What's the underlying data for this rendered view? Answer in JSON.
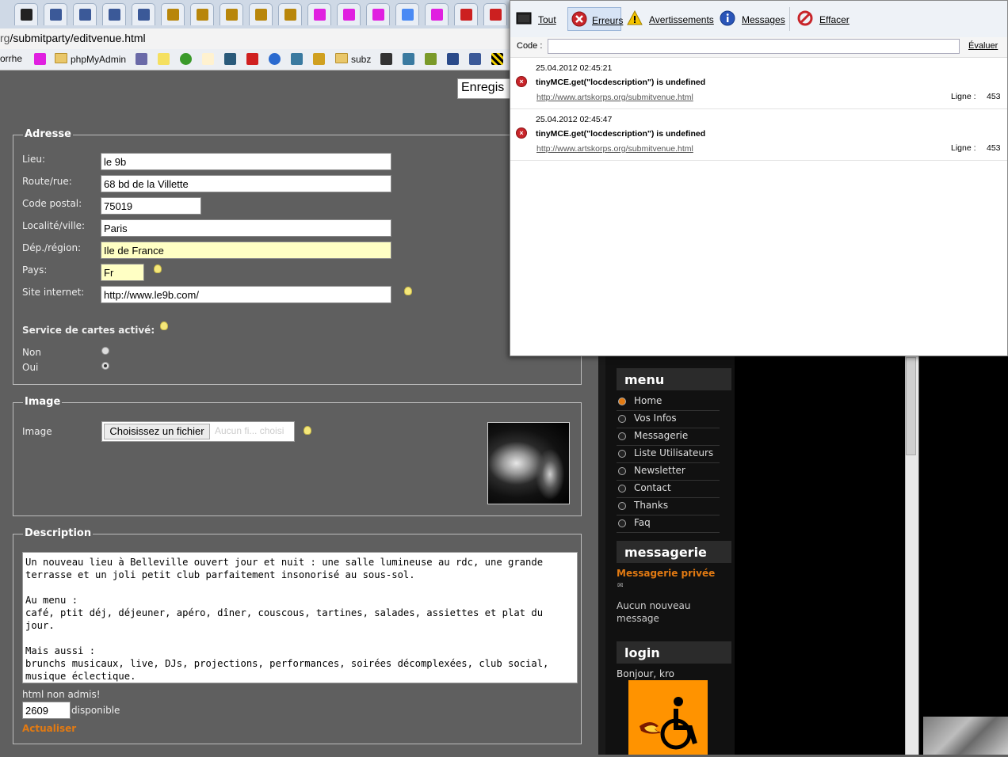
{
  "browser": {
    "url_prefix": "rg",
    "url_path": "/submitparty/editvenue.html",
    "tabs": [
      {
        "icon": "mediawiki-icon",
        "color": "#222222"
      },
      {
        "icon": "facebook-icon",
        "color": "#3b5998"
      },
      {
        "icon": "facebook-icon",
        "color": "#3b5998"
      },
      {
        "icon": "facebook-icon",
        "color": "#3b5998"
      },
      {
        "icon": "facebook-icon",
        "color": "#3b5998"
      },
      {
        "icon": "artskorps-icon",
        "color": "#b8860b"
      },
      {
        "icon": "artskorps-icon",
        "color": "#b8860b"
      },
      {
        "icon": "artskorps-icon",
        "color": "#b8860b"
      },
      {
        "icon": "artskorps-icon",
        "color": "#b8860b"
      },
      {
        "icon": "artskorps-icon",
        "color": "#b8860b"
      },
      {
        "icon": "hourglass-icon",
        "color": "#e020e0"
      },
      {
        "icon": "hourglass-icon",
        "color": "#e020e0"
      },
      {
        "icon": "hourglass-icon",
        "color": "#e020e0"
      },
      {
        "icon": "google-icon",
        "color": "#4a8af4"
      },
      {
        "icon": "hourglass-icon",
        "color": "#e020e0"
      },
      {
        "icon": "youtube-icon",
        "color": "#cc2020"
      },
      {
        "icon": "youtube-icon",
        "color": "#cc2020"
      }
    ],
    "bookmarks": {
      "first_partial": "orrhe",
      "phpmyadmin": "phpMyAdmin",
      "subz": "subz"
    }
  },
  "form": {
    "save_button": "Enregis",
    "address": {
      "legend": "Adresse",
      "lieu_label": "Lieu:",
      "lieu_value": "le 9b",
      "route_label": "Route/rue:",
      "route_value": "68 bd de la Villette",
      "cp_label": "Code postal:",
      "cp_value": "75019",
      "ville_label": "Localité/ville:",
      "ville_value": "Paris",
      "region_label": "Dép./région:",
      "region_value": "Ile de France",
      "pays_label": "Pays:",
      "pays_value": "Fr",
      "site_label": "Site internet:",
      "site_value": "http://www.le9b.com/",
      "maps_label": "Service de cartes activé:",
      "non_label": "Non",
      "oui_label": "Oui",
      "maps_selected": "Oui"
    },
    "image": {
      "legend": "Image",
      "label": "Image",
      "file_button": "Choisissez un fichier",
      "file_status": "Aucun fi... choisi"
    },
    "description": {
      "legend": "Description",
      "text": "Un nouveau lieu à Belleville ouvert jour et nuit : une salle lumineuse au rdc, une grande terrasse et un joli petit club parfaitement insonorisé au sous-sol.\n\nAu menu :\ncafé, ptit déj, déjeuner, apéro, dîner, couscous, tartines, salades, assiettes et plat du jour.\n\nMais aussi :\nbrunchs musicaux, live, DJs, projections, performances, soirées décomplexées, club social, musique éclectique.",
      "html_note": "html non admis!",
      "chars_left": "2609",
      "chars_label": "disponible",
      "update_link": "Actualiser"
    }
  },
  "sidebar": {
    "menu_title": "menu",
    "menu_items": [
      "Home",
      "Vos Infos",
      "Messagerie",
      "Liste Utilisateurs",
      "Newsletter",
      "Contact",
      "Thanks",
      "Faq"
    ],
    "messaging_title": "messagerie",
    "private_messages": "Messagerie privée",
    "no_new_message": "Aucun nouveau message",
    "login_title": "login",
    "greeting": "Bonjour, kro",
    "accent_color": "#e27a12"
  },
  "console": {
    "toolbar": {
      "all": "Tout",
      "errors": "Erreurs",
      "warnings": "Avertissements",
      "messages": "Messages",
      "clear": "Effacer"
    },
    "code_label": "Code :",
    "evaluate": "Évaluer",
    "entries": [
      {
        "timestamp": "25.04.2012 02:45:21",
        "message": "tinyMCE.get(\"locdescription\") is undefined",
        "url": "http://www.artskorps.org/submitvenue.html",
        "line_label": "Ligne :",
        "line": "453"
      },
      {
        "timestamp": "25.04.2012 02:45:47",
        "message": "tinyMCE.get(\"locdescription\") is undefined",
        "url": "http://www.artskorps.org/submitvenue.html",
        "line_label": "Ligne :",
        "line": "453"
      }
    ]
  }
}
